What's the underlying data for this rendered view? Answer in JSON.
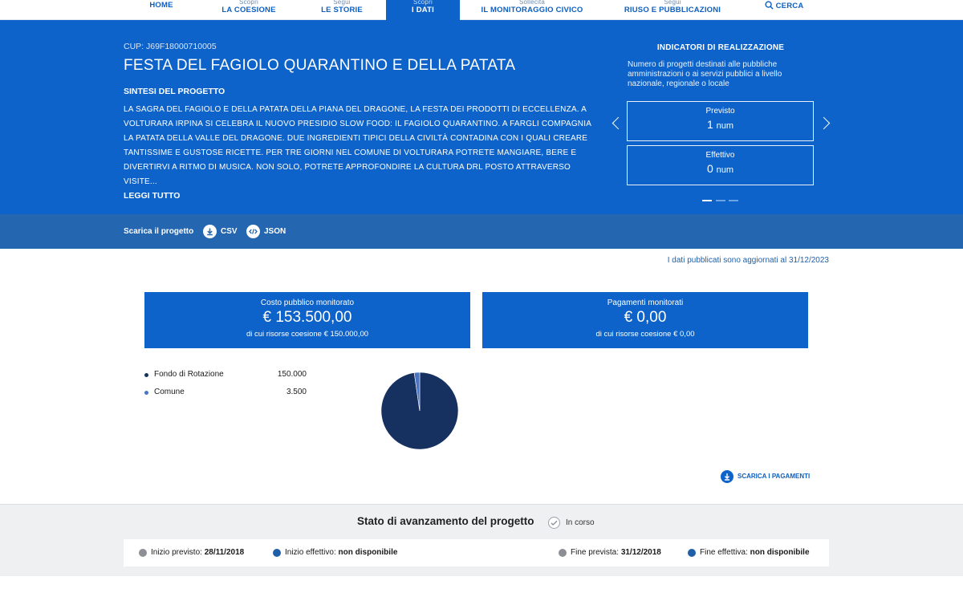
{
  "nav": {
    "home": "HOME",
    "items": [
      {
        "small": "Scopri",
        "big": "LA COESIONE"
      },
      {
        "small": "Segui",
        "big": "LE STORIE"
      },
      {
        "small": "Scopri",
        "big": "I DATI"
      },
      {
        "small": "Sollecita",
        "big": "IL MONITORAGGIO CIVICO"
      },
      {
        "small": "Segui",
        "big": "RIUSO E PUBBLICAZIONI"
      }
    ],
    "search": "CERCA",
    "active_index": 2
  },
  "project": {
    "cup": "CUP: J69F18000710005",
    "title": "FESTA DEL FAGIOLO QUARANTINO E DELLA PATATA",
    "synthesis_heading": "SINTESI DEL PROGETTO",
    "synthesis_text": "LA SAGRA DEL FAGIOLO E DELLA PATATA DELLA PIANA DEL DRAGONE, LA FESTA DEI PRODOTTI DI ECCELLENZA. A VOLTURARA IRPINA SI CELEBRA IL NUOVO PRESIDIO SLOW FOOD: IL FAGIOLO QUARANTINO. A FARGLI COMPAGNIA LA PATATA DELLA VALLE DEL DRAGONE. DUE INGREDIENTI TIPICI DELLA CIVILTÀ  CONTADINA CON I QUALI CREARE TANTISSIME E GUSTOSE RICETTE. PER TRE GIORNI NEL COMUNE DI VOLTURARA POTRETE MANGIARE, BERE E DIVERTIRVI A RITMO DI MUSICA. NON SOLO, POTRETE APPROFONDIRE LA CULTURA DRL POSTO ATTRAVERSO VISITE...",
    "read_more": "LEGGI TUTTO"
  },
  "indicators": {
    "title": "INDICATORI DI REALIZZAZIONE",
    "description": "Numero di progetti destinati alle pubbliche amministrazioni o ai servizi pubblici a livello nazionale, regionale o locale",
    "planned_label": "Previsto",
    "planned_value": "1",
    "planned_unit": "num",
    "actual_label": "Effettivo",
    "actual_value": "0",
    "actual_unit": "num",
    "slides": 3,
    "active_slide": 0
  },
  "download": {
    "label": "Scarica il progetto",
    "csv": "CSV",
    "json": "JSON"
  },
  "updated": "I dati pubblicati sono aggiornati al 31/12/2023",
  "costs": {
    "public_title": "Costo pubblico monitorato",
    "public_value": "€ 153.500,00",
    "public_sub": "di cui risorse coesione € 150.000,00",
    "payments_title": "Pagamenti monitorati",
    "payments_value": "€ 0,00",
    "payments_sub": "di cui risorse coesione € 0,00"
  },
  "funding": [
    {
      "name": "Fondo di Rotazione",
      "amount": "150.000"
    },
    {
      "name": "Comune",
      "amount": "3.500"
    }
  ],
  "chart_data": {
    "type": "pie",
    "categories": [
      "Fondo di Rotazione",
      "Comune"
    ],
    "values": [
      150000,
      3500
    ],
    "colors": [
      "#16315f",
      "#4a74c4"
    ]
  },
  "download_payments": "SCARICA I PAGAMENTI",
  "status": {
    "title": "Stato di avanzamento del progetto",
    "badge": "In corso",
    "dates": [
      {
        "label": "Inizio previsto:",
        "value": "28/11/2018",
        "color": "#8c8f93"
      },
      {
        "label": "Inizio effettivo:",
        "value": "non disponibile",
        "color": "#1f5fa8"
      },
      {
        "label": "Fine prevista:",
        "value": "31/12/2018",
        "color": "#8c8f93"
      },
      {
        "label": "Fine effettiva:",
        "value": "non disponibile",
        "color": "#1f5fa8"
      }
    ]
  }
}
